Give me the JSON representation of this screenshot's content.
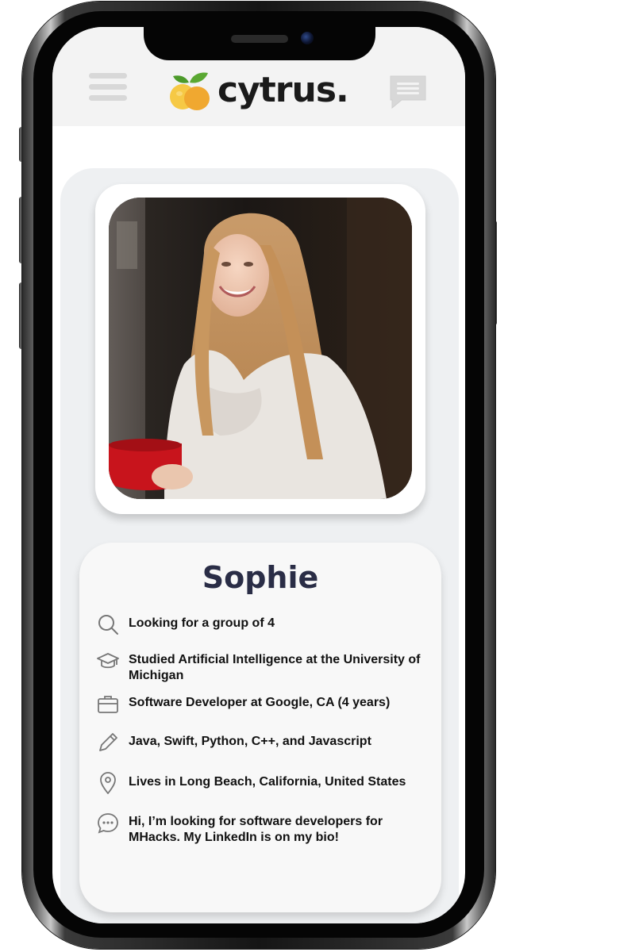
{
  "app": {
    "brand_name": "cytrus.",
    "accent_color": "#2a2d46",
    "logo_colors": [
      "#f4c542",
      "#f0a830",
      "#5aa832"
    ]
  },
  "header": {
    "menu_icon": "hamburger-menu-icon",
    "chat_icon": "chat-bubble-icon"
  },
  "profile": {
    "name": "Sophie",
    "photo_description_icon": "profile-photo",
    "details": [
      {
        "icon": "search-icon",
        "text": "Looking for a group of 4"
      },
      {
        "icon": "graduation-cap-icon",
        "text": "Studied Artificial Intelligence at the University of Michigan"
      },
      {
        "icon": "briefcase-icon",
        "text": "Software Developer at Google, CA (4 years)"
      },
      {
        "icon": "pencil-icon",
        "text": "Java, Swift, Python, C++, and Javascript"
      },
      {
        "icon": "location-pin-icon",
        "text": "Lives in Long Beach, California, United States"
      },
      {
        "icon": "speech-bubble-icon",
        "text": "Hi, I’m looking for software developers for MHacks. My LinkedIn is on my bio!"
      }
    ]
  }
}
